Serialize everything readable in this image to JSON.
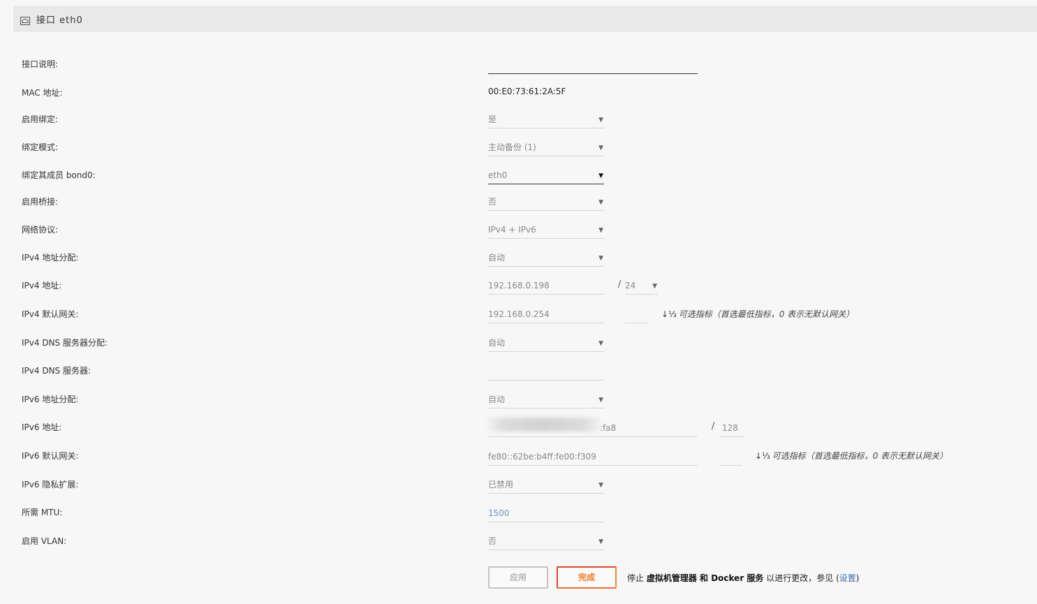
{
  "header": {
    "icon": "interface-icon",
    "title": "接口 eth0"
  },
  "rows": {
    "description": {
      "label": "接口说明:",
      "value": ""
    },
    "mac": {
      "label": "MAC 地址:",
      "value": "00:E0:73:61:2A:5F"
    },
    "bonding": {
      "label": "启用绑定:",
      "value": "是"
    },
    "bond_mode": {
      "label": "绑定模式:",
      "value": "主动备份 (1)"
    },
    "bond_members": {
      "label": "绑定其成员 bond0:",
      "value": "eth0"
    },
    "bridging": {
      "label": "启用桥接:",
      "value": "否"
    },
    "protocol": {
      "label": "网络协议:",
      "value": "IPv4 + IPv6"
    },
    "ipv4_assign": {
      "label": "IPv4 地址分配:",
      "value": "自动"
    },
    "ipv4_addr": {
      "label": "IPv4 地址:",
      "value": "192.168.0.198",
      "prefix_sep": "/",
      "prefix": "24"
    },
    "ipv4_gw": {
      "label": "IPv4 默认网关:",
      "value": "192.168.0.254",
      "metric": "",
      "hint": "可选指标（首选最低指标，0 表示无默认网关）"
    },
    "ipv4_dns_assign": {
      "label": "IPv4 DNS 服务器分配:",
      "value": "自动"
    },
    "ipv4_dns": {
      "label": "IPv4 DNS 服务器:",
      "value": ""
    },
    "ipv6_assign": {
      "label": "IPv6 地址分配:",
      "value": "自动"
    },
    "ipv6_addr": {
      "label": "IPv6 地址:",
      "value": ":fa8",
      "prefix_sep": "/",
      "prefix": "128"
    },
    "ipv6_gw": {
      "label": "IPv6 默认网关:",
      "value": "fe80::62be:b4ff:fe00:f309",
      "metric": "",
      "hint": "可选指标（首选最低指标，0 表示无默认网关）"
    },
    "ipv6_privacy": {
      "label": "IPv6 隐私扩展:",
      "value": "已禁用"
    },
    "mtu": {
      "label": "所需 MTU:",
      "value": "1500"
    },
    "vlan": {
      "label": "启用 VLAN:",
      "value": "否"
    }
  },
  "icons": {
    "dropdown": "▼",
    "sort": "↓⅓"
  },
  "buttons": {
    "apply": "应用",
    "done": "完成"
  },
  "note": {
    "prefix": "停止 ",
    "vm": "虚拟机管理器",
    "and": " 和 ",
    "docker": "Docker 服务",
    "suffix": " 以进行更改，参见 ",
    "open_paren": "(",
    "link": "设置",
    "close_paren": ")"
  }
}
